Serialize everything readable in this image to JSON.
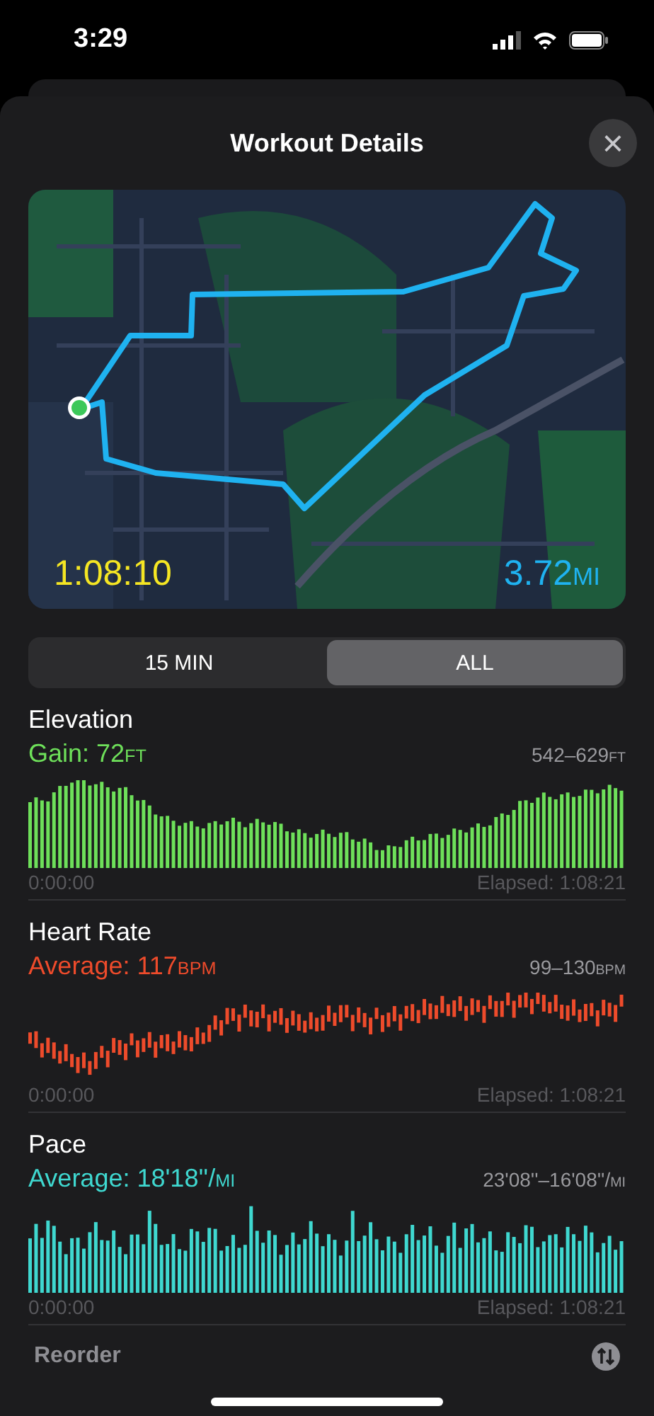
{
  "status_bar": {
    "time": "3:29"
  },
  "sheet": {
    "title": "Workout Details",
    "close": "×"
  },
  "map": {
    "kind": "picture",
    "duration": "1:08:10",
    "distance": {
      "value": "3.72",
      "unit": "MI"
    }
  },
  "segments": [
    {
      "label": "15 MIN",
      "selected": false
    },
    {
      "label": "ALL",
      "selected": true
    }
  ],
  "metrics": [
    {
      "title": "Elevation",
      "kind": "bars",
      "color": "#6ee05a",
      "summary": {
        "text": "Gain: 72",
        "unit": "FT"
      },
      "range": {
        "text": "542–629",
        "unit": "FT"
      },
      "start": "0:00:00",
      "end": "Elapsed: 1:08:21"
    },
    {
      "title": "Heart Rate",
      "kind": "ranges",
      "color": "#ee4b2b",
      "summary": {
        "text": "Average: 117",
        "unit": "BPM"
      },
      "range": {
        "text": "99–130",
        "unit": "BPM"
      },
      "start": "0:00:00",
      "end": "Elapsed: 1:08:21"
    },
    {
      "title": "Pace",
      "kind": "spikes",
      "color": "#3fd8d0",
      "summary": {
        "text": "Average: 18'18''/",
        "unit": "MI"
      },
      "range": {
        "text": "23'08''–16'08''/",
        "unit": "MI"
      },
      "start": "0:00:00",
      "end": "Elapsed: 1:08:21"
    }
  ],
  "footer": {
    "label": "Reorder"
  }
}
